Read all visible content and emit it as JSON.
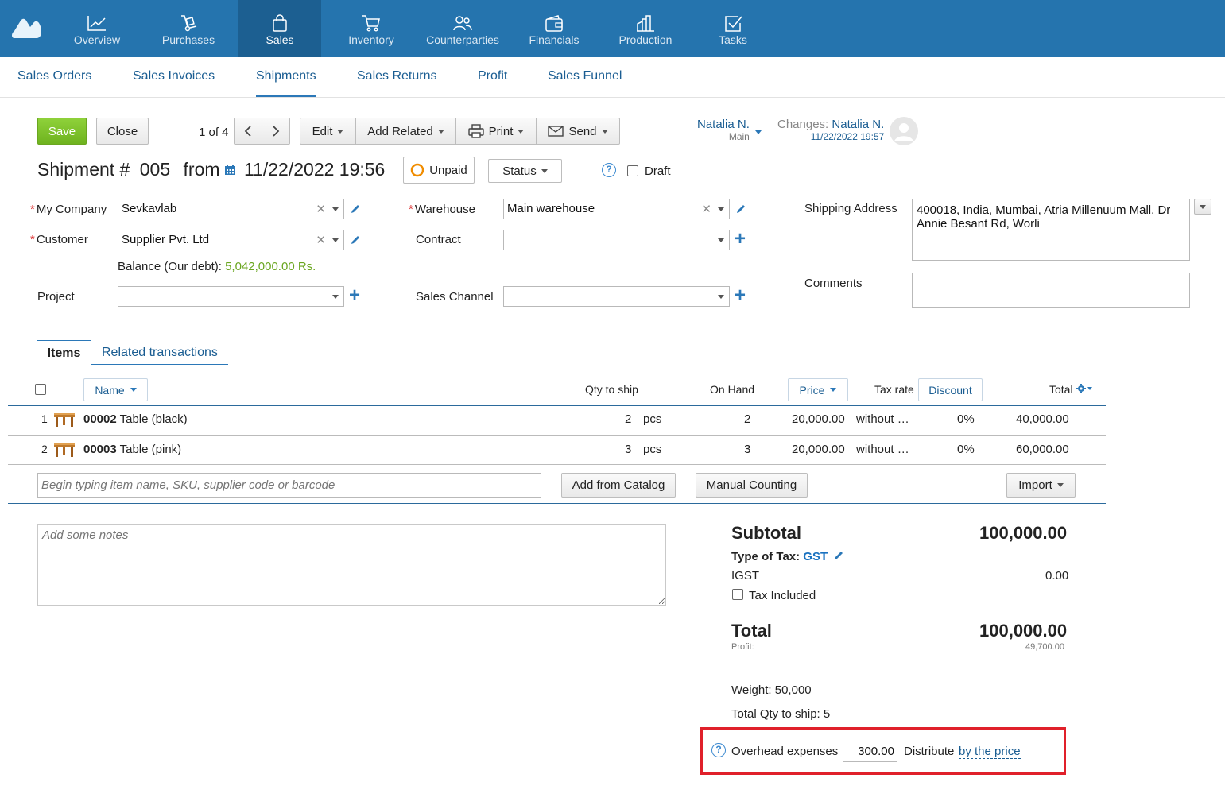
{
  "nav": {
    "items": [
      {
        "label": "Overview",
        "icon": "chart-line-icon"
      },
      {
        "label": "Purchases",
        "icon": "hand-truck-icon"
      },
      {
        "label": "Sales",
        "icon": "shopping-bag-icon"
      },
      {
        "label": "Inventory",
        "icon": "cart-icon"
      },
      {
        "label": "Counterparties",
        "icon": "people-icon"
      },
      {
        "label": "Financials",
        "icon": "wallet-icon"
      },
      {
        "label": "Production",
        "icon": "factory-icon"
      },
      {
        "label": "Tasks",
        "icon": "checkbox-icon"
      }
    ],
    "active": "Sales"
  },
  "subnav": {
    "items": [
      "Sales Orders",
      "Sales Invoices",
      "Shipments",
      "Sales Returns",
      "Profit",
      "Sales Funnel"
    ],
    "active": "Shipments"
  },
  "toolbar": {
    "save": "Save",
    "close": "Close",
    "pager": "1 of 4",
    "edit": "Edit",
    "add_related": "Add Related",
    "print": "Print",
    "send": "Send"
  },
  "owner": {
    "name": "Natalia N.",
    "group": "Main"
  },
  "changes": {
    "label": "Changes:",
    "name": "Natalia N.",
    "date": "11/22/2022 19:57"
  },
  "doc": {
    "title_prefix": "Shipment #",
    "number": "005",
    "from": "from",
    "date": "11/22/2022 19:56",
    "payment_status": "Unpaid",
    "status_button": "Status",
    "draft_label": "Draft"
  },
  "form": {
    "my_company": {
      "label": "My Company",
      "value": "Sevkavlab"
    },
    "customer": {
      "label": "Customer",
      "value": "Supplier Pvt. Ltd"
    },
    "balance": {
      "label": "Balance (Our debt):",
      "value": "5,042,000.00 Rs."
    },
    "project": {
      "label": "Project",
      "value": ""
    },
    "warehouse": {
      "label": "Warehouse",
      "value": "Main warehouse"
    },
    "contract": {
      "label": "Contract",
      "value": ""
    },
    "sales_channel": {
      "label": "Sales Channel",
      "value": ""
    },
    "shipping_address": {
      "label": "Shipping Address",
      "value": "400018, India, Mumbai, Atria Millenuum Mall, Dr Annie Besant Rd, Worli"
    },
    "comments": {
      "label": "Comments",
      "value": ""
    }
  },
  "tabs": {
    "items": "Items",
    "related": "Related transactions"
  },
  "table": {
    "headers": {
      "name": "Name",
      "qty": "Qty to ship",
      "on_hand": "On Hand",
      "price": "Price",
      "tax_rate": "Tax rate",
      "discount": "Discount",
      "total": "Total"
    },
    "rows": [
      {
        "num": "1",
        "code": "00002",
        "name": "Table (black)",
        "qty": "2",
        "unit": "pcs",
        "on_hand": "2",
        "price": "20,000.00",
        "tax": "without …",
        "discount": "0%",
        "total": "40,000.00"
      },
      {
        "num": "2",
        "code": "00003",
        "name": "Table (pink)",
        "qty": "3",
        "unit": "pcs",
        "on_hand": "3",
        "price": "20,000.00",
        "tax": "without …",
        "discount": "0%",
        "total": "60,000.00"
      }
    ],
    "add_item_placeholder": "Begin typing item name, SKU, supplier code or barcode",
    "add_from_catalog": "Add from Catalog",
    "manual_counting": "Manual Counting",
    "import": "Import"
  },
  "notes": {
    "placeholder": "Add some notes"
  },
  "summary": {
    "subtotal_label": "Subtotal",
    "subtotal_value": "100,000.00",
    "tax_type_label": "Type of Tax:",
    "tax_type_value": "GST",
    "igst_label": "IGST",
    "igst_value": "0.00",
    "tax_included_label": "Tax Included",
    "total_label": "Total",
    "total_value": "100,000.00",
    "profit_label": "Profit:",
    "profit_value": "49,700.00",
    "weight": "Weight: 50,000",
    "total_qty": "Total Qty to ship: 5",
    "overhead_label": "Overhead expenses",
    "overhead_value": "300.00",
    "distribute_label": "Distribute",
    "distribute_value": "by the price"
  },
  "colors": {
    "nav_bg": "#2574ae",
    "nav_active": "#1c5f91",
    "link": "#1a5d92",
    "save_green": "#7cc12a",
    "balance_green": "#6aa620",
    "unpaid_orange": "#f08c00",
    "highlight_red": "#e0202a"
  }
}
